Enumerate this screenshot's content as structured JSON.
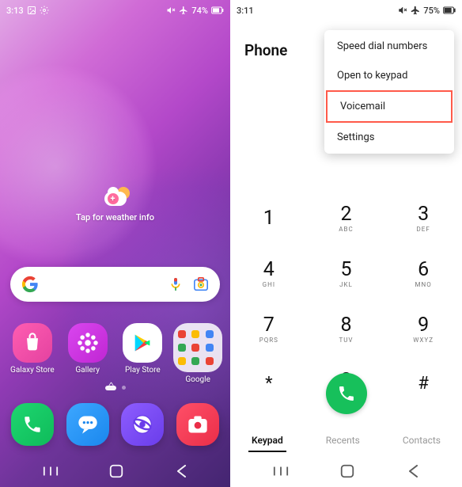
{
  "left": {
    "status": {
      "time": "3:13",
      "battery_text": "74%",
      "icons": [
        "image-icon",
        "gear-icon",
        "mute-icon",
        "airplane-icon",
        "battery-icon"
      ]
    },
    "weather_label": "Tap for weather info",
    "search_placeholder": "",
    "apps": [
      {
        "id": "galaxy-store",
        "label": "Galaxy Store"
      },
      {
        "id": "gallery",
        "label": "Gallery"
      },
      {
        "id": "play-store",
        "label": "Play Store"
      },
      {
        "id": "google-folder",
        "label": "Google"
      }
    ],
    "dock": [
      "phone",
      "messages",
      "internet",
      "camera"
    ],
    "nav": [
      "recents",
      "home",
      "back"
    ]
  },
  "right": {
    "status": {
      "time": "3:11",
      "battery_text": "75%"
    },
    "title": "Phone",
    "menu": [
      "Speed dial numbers",
      "Open to keypad",
      "Voicemail",
      "Settings"
    ],
    "menu_highlighted_index": 2,
    "keypad": [
      {
        "n": "1",
        "l": ""
      },
      {
        "n": "2",
        "l": "ABC"
      },
      {
        "n": "3",
        "l": "DEF"
      },
      {
        "n": "4",
        "l": "GHI"
      },
      {
        "n": "5",
        "l": "JKL"
      },
      {
        "n": "6",
        "l": "MNO"
      },
      {
        "n": "7",
        "l": "PQRS"
      },
      {
        "n": "8",
        "l": "TUV"
      },
      {
        "n": "9",
        "l": "WXYZ"
      },
      {
        "n": "*",
        "l": ""
      },
      {
        "n": "0",
        "l": "+"
      },
      {
        "n": "#",
        "l": ""
      }
    ],
    "tabs": [
      {
        "label": "Keypad",
        "active": true
      },
      {
        "label": "Recents",
        "active": false
      },
      {
        "label": "Contacts",
        "active": false
      }
    ]
  }
}
